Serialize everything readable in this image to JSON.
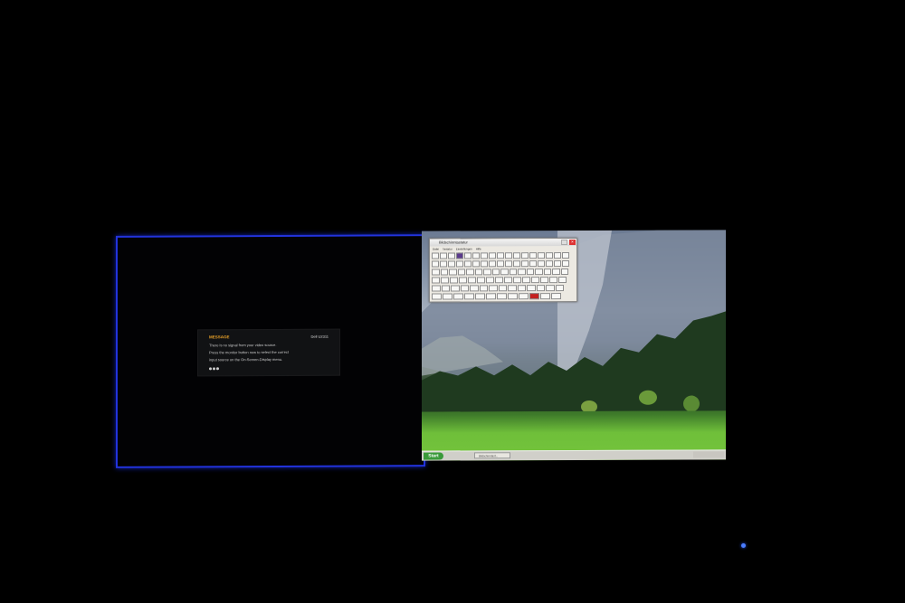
{
  "left_monitor": {
    "osd": {
      "title": "MESSAGE",
      "model": "Dell U2311",
      "lines": [
        "There is no signal from your video source.",
        "Press the monitor button now to select the correct",
        "input source on the On-Screen-Display menu."
      ]
    }
  },
  "right_monitor": {
    "osk": {
      "title": "Bildschirmtastatur",
      "menu": [
        "Datei",
        "Tastatur",
        "Einstellungen",
        "Hilfe"
      ]
    },
    "taskbar": {
      "start_label": "Start",
      "task_item": "Bildschirmtast..."
    }
  },
  "colors": {
    "monitor_border": "#2233dd",
    "osd_title": "#e8a028",
    "power_led": "#4a7dff"
  }
}
